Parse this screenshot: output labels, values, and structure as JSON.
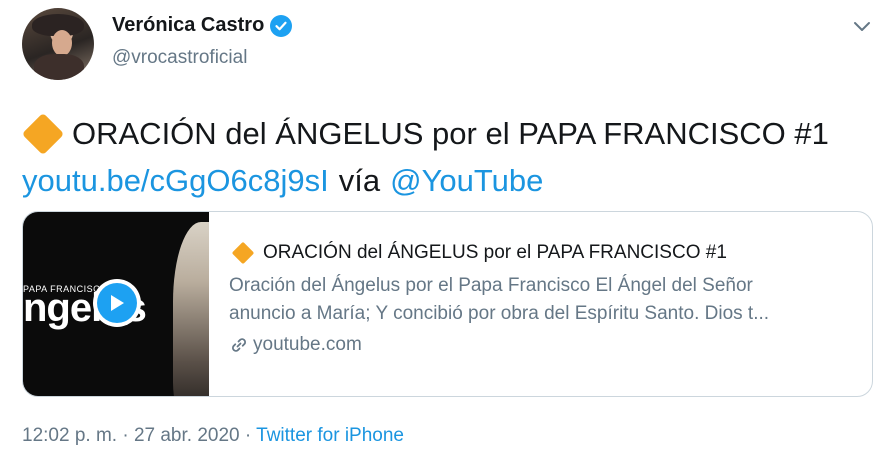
{
  "author": {
    "display_name": "Verónica Castro",
    "handle": "@vrocastroficial",
    "verified": true
  },
  "tweet": {
    "emoji": "orange-diamond",
    "text_line1": "ORACIÓN del ÁNGELUS por el PAPA FRANCISCO #1",
    "link": "youtu.be/cGgO6c8j9sI",
    "via": "vía",
    "mention": "@YouTube"
  },
  "card": {
    "thumbnail_small_text": "PAPA FRANCISCO",
    "thumbnail_big_text": "ngelus",
    "title": "ORACIÓN del ÁNGELUS por el PAPA FRANCISCO #1",
    "description_line1": "Oración del Ángelus por el Papa Francisco El Ángel del Señor",
    "description_line2": "anuncio a María; Y concibió por obra del Espíritu Santo. Dios t...",
    "domain": "youtube.com"
  },
  "meta": {
    "time": "12:02 p. m.",
    "separator1": "·",
    "date": "27 abr. 2020",
    "separator2": "·",
    "source": "Twitter for iPhone"
  },
  "colors": {
    "link": "#1b95e0",
    "verified": "#1da1f2",
    "secondary_text": "#657786",
    "emoji": "#f5a623"
  }
}
